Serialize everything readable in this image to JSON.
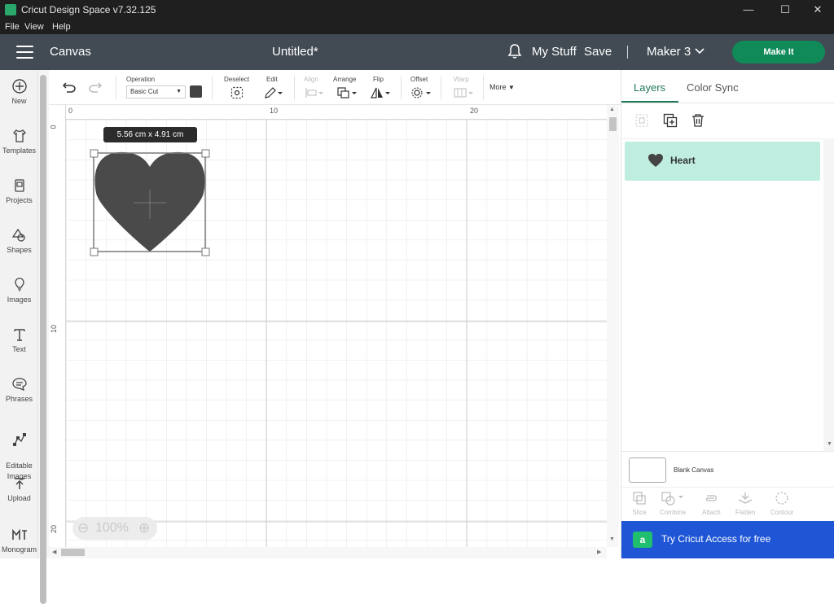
{
  "app": {
    "title": "Cricut Design Space  v7.32.125"
  },
  "window_controls": {
    "minimize": "—",
    "maximize": "☐",
    "close": "✕"
  },
  "menu": [
    "File",
    "View",
    "Help"
  ],
  "header": {
    "section": "Canvas",
    "document_title": "Untitled*",
    "my_stuff": "My Stuff",
    "save": "Save",
    "separator": "|",
    "machine": "Maker 3",
    "make_it": "Make It"
  },
  "sidebar": [
    {
      "icon": "new-icon",
      "label": "New"
    },
    {
      "icon": "templates-icon",
      "label": "Templates"
    },
    {
      "icon": "projects-icon",
      "label": "Projects"
    },
    {
      "icon": "shapes-icon",
      "label": "Shapes"
    },
    {
      "icon": "images-icon",
      "label": "Images"
    },
    {
      "icon": "text-icon",
      "label": "Text"
    },
    {
      "icon": "phrases-icon",
      "label": "Phrases"
    },
    {
      "icon": "editable-images-icon",
      "label": "Editable\nImages"
    },
    {
      "icon": "upload-icon",
      "label": "Upload"
    },
    {
      "icon": "monogram-icon",
      "label": "Monogram"
    }
  ],
  "toolbar": {
    "operation_label": "Operation",
    "operation_value": "Basic Cut",
    "operation_color": "#424242",
    "deselect": "Deselect",
    "edit": "Edit",
    "align": "Align",
    "arrange": "Arrange",
    "flip": "Flip",
    "offset": "Offset",
    "warp": "Warp",
    "more": "More"
  },
  "rulers": {
    "horizontal": [
      "0",
      "10",
      "20"
    ],
    "vertical": [
      "0",
      "10",
      "20"
    ]
  },
  "selection": {
    "dimensions": "5.56  cm x 4.91  cm",
    "shape": "heart",
    "fill": "#4a4a4a"
  },
  "zoom": {
    "level": "100%"
  },
  "panel": {
    "tabs": [
      "Layers",
      "Color Sync"
    ],
    "active_tab": "Layers",
    "layers": [
      {
        "name": "Heart",
        "icon": "heart-icon"
      }
    ],
    "blank_canvas_label": "Blank Canvas",
    "tools": [
      "Slice",
      "Combine",
      "Attach",
      "Flatten",
      "Contour"
    ],
    "access_banner": "Try Cricut Access for free",
    "access_logo": "a"
  },
  "colors": {
    "header_bg": "#424b54",
    "make_it": "#0f8a58",
    "accent_green": "#1f7a56",
    "layer_selected_bg": "#bfeee0",
    "access_banner_bg": "#1f56d6"
  }
}
